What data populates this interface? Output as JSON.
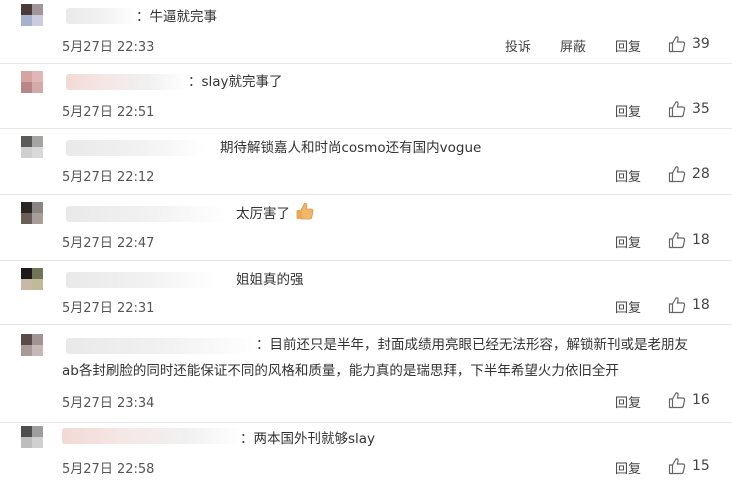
{
  "comments": [
    {
      "text": "：牛逼就完事",
      "time": "5月27日 22:33",
      "actions": [
        "投诉",
        "屏蔽",
        "回复"
      ],
      "likes": "39",
      "avatar_colors": [
        "#4a3a3a",
        "#a8b0cf"
      ],
      "name_tint": false
    },
    {
      "text": "：slay就完事了",
      "time": "5月27日 22:51",
      "actions": [
        "回复"
      ],
      "likes": "35",
      "avatar_colors": [
        "#d6a2a2",
        "#b88888"
      ],
      "name_tint": true
    },
    {
      "text": "期待解锁嘉人和时尚cosmo还有国内vogue",
      "time": "5月27日 22:12",
      "actions": [
        "回复"
      ],
      "likes": "28",
      "avatar_colors": [
        "#5a5a58",
        "#cfcfcf"
      ],
      "name_tint": false
    },
    {
      "text": "太厉害了",
      "time": "5月27日 22:47",
      "actions": [
        "回复"
      ],
      "likes": "18",
      "avatar_colors": [
        "#2b2624",
        "#6b5e58"
      ],
      "name_tint": false
    },
    {
      "text": "姐姐真的强",
      "time": "5月27日 22:31",
      "actions": [
        "回复"
      ],
      "likes": "18",
      "avatar_colors": [
        "#1e1a1a",
        "#c9b7a8"
      ],
      "name_tint": false
    },
    {
      "text": "：目前还只是半年，封面成绩用亮眼已经无法形容，解锁新刊或是老朋友ab各封刷脸的同时还能保证不同的风格和质量，能力真的是瑞思拜，下半年希望火力依旧全开",
      "time": "5月27日 23:34",
      "actions": [
        "回复"
      ],
      "likes": "16",
      "avatar_colors": [
        "#5b4a48",
        "#a99a98"
      ],
      "name_tint": false
    },
    {
      "text": "：两本国外刊就够slay",
      "time": "5月27日 22:58",
      "actions": [
        "回复"
      ],
      "likes": "15",
      "avatar_colors": [
        "#4e4e4c",
        "#bdbdbd"
      ],
      "name_tint": true
    }
  ],
  "icons": {
    "like": "thumbs-up-icon",
    "emoji": "thumbs-up-emoji-icon"
  },
  "colors": {
    "text": "#333333",
    "meta": "#555555",
    "divider": "#e6e6e6",
    "emoji": "#f0b66a"
  }
}
